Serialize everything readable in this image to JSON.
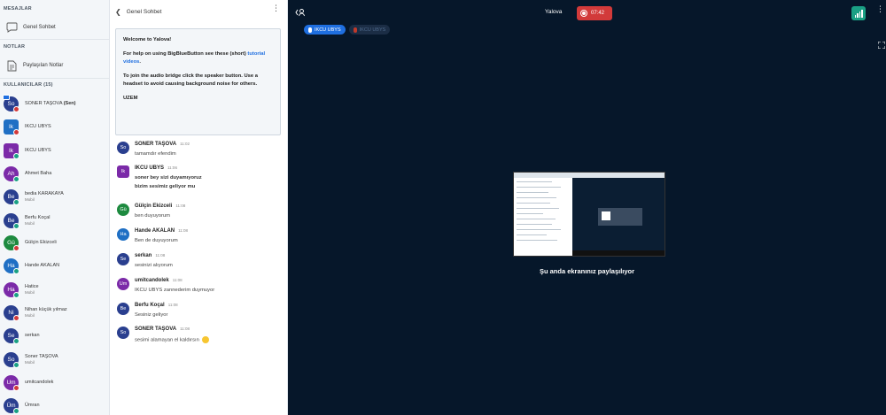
{
  "sidebar": {
    "messages_title": "MESAJLAR",
    "public_chat_label": "Genel Sohbet",
    "notes_title": "NOTLAR",
    "shared_notes_label": "Paylaşılan Notlar",
    "users_title": "KULLANICILAR (15)"
  },
  "users": [
    {
      "initials": "So",
      "name": "SONER TAŞOVA",
      "you": "(Sen)",
      "role": "",
      "color": "#2a3f8f",
      "square": false,
      "status": "mic-muted",
      "presenter": true
    },
    {
      "initials": "Ik",
      "name": "IKCU UBYS",
      "you": "",
      "role": "",
      "color": "#1f6fc4",
      "square": true,
      "status": "mic-muted",
      "presenter": false
    },
    {
      "initials": "Ik",
      "name": "IKCU UBYS",
      "you": "",
      "role": "",
      "color": "#7b2aa8",
      "square": true,
      "status": "listen",
      "presenter": false
    },
    {
      "initials": "Ah",
      "name": "Ahmet Baha",
      "you": "",
      "role": "",
      "color": "#7b2aa8",
      "square": false,
      "status": "listen",
      "presenter": false
    },
    {
      "initials": "Be",
      "name": "bedia KARAKAYA",
      "you": "",
      "role": "Mobil",
      "color": "#2a3f8f",
      "square": false,
      "status": "listen",
      "presenter": false
    },
    {
      "initials": "Be",
      "name": "Berfu Koçal",
      "you": "",
      "role": "Mobil",
      "color": "#2a3f8f",
      "square": false,
      "status": "listen",
      "presenter": false
    },
    {
      "initials": "Gü",
      "name": "Gülçin Ekizceli",
      "you": "",
      "role": "",
      "color": "#1d8a3f",
      "square": false,
      "status": "mic-muted",
      "presenter": false
    },
    {
      "initials": "Ha",
      "name": "Hande AKALAN",
      "you": "",
      "role": "",
      "color": "#1f6fc4",
      "square": false,
      "status": "listen",
      "presenter": false
    },
    {
      "initials": "Ha",
      "name": "Hatice",
      "you": "",
      "role": "Mobil",
      "color": "#7b2aa8",
      "square": false,
      "status": "listen",
      "presenter": false
    },
    {
      "initials": "Ni",
      "name": "Nihan küçük yılmaz",
      "you": "",
      "role": "Mobil",
      "color": "#2a3f8f",
      "square": false,
      "status": "mic-muted",
      "presenter": false
    },
    {
      "initials": "Se",
      "name": "serkan",
      "you": "",
      "role": "",
      "color": "#2a3f8f",
      "square": false,
      "status": "listen",
      "presenter": false
    },
    {
      "initials": "So",
      "name": "Soner TAŞOVA",
      "you": "",
      "role": "Mobil",
      "color": "#2a3f8f",
      "square": false,
      "status": "listen",
      "presenter": false
    },
    {
      "initials": "Um",
      "name": "umitcandolek",
      "you": "",
      "role": "",
      "color": "#7b2aa8",
      "square": false,
      "status": "mic-muted",
      "presenter": false
    },
    {
      "initials": "Üm",
      "name": "Ümran",
      "you": "",
      "role": "",
      "color": "#2a3f8f",
      "square": false,
      "status": "listen",
      "presenter": false
    }
  ],
  "chat": {
    "title": "Genel Sohbet",
    "welcome": {
      "line1": "Welcome to Yalova!",
      "line2_pre": "For help on using BigBlueButton see these (short) ",
      "line2_link": "tutorial videos",
      "line2_post": ".",
      "line3": "To join the audio bridge click the speaker button. Use a headset to avoid causing background noise for others.",
      "line4": "UZEM"
    },
    "messages": [
      {
        "initials": "So",
        "name": "SONER TAŞOVA",
        "time": "11:02",
        "color": "#2a3f8f",
        "square": false,
        "lines": [
          "tamamdır efendim"
        ],
        "bold": false
      },
      {
        "initials": "Ik",
        "name": "IKCU UBYS",
        "time": "11:06",
        "color": "#7b2aa8",
        "square": true,
        "lines": [
          "soner bey sizi duyamıyoruz",
          "bizim sesimiz geliyor mu"
        ],
        "bold": true
      },
      {
        "initials": "Gü",
        "name": "Gülçin Ekizceli",
        "time": "11:08",
        "color": "#1d8a3f",
        "square": false,
        "lines": [
          "ben duyuyorum"
        ],
        "bold": false
      },
      {
        "initials": "Ha",
        "name": "Hande AKALAN",
        "time": "11:08",
        "color": "#1f6fc4",
        "square": false,
        "lines": [
          "Ben de duyuyorum"
        ],
        "bold": false
      },
      {
        "initials": "Se",
        "name": "serkan",
        "time": "11:08",
        "color": "#2a3f8f",
        "square": false,
        "lines": [
          "sesinizi alıyorum"
        ],
        "bold": false
      },
      {
        "initials": "Um",
        "name": "umitcandolek",
        "time": "11:08",
        "color": "#7b2aa8",
        "square": false,
        "lines": [
          "IKCU UBYS zannederim duymuyor"
        ],
        "bold": false
      },
      {
        "initials": "Be",
        "name": "Berfu Koçal",
        "time": "11:08",
        "color": "#2a3f8f",
        "square": false,
        "lines": [
          "Sesiniz geliyor"
        ],
        "bold": false
      },
      {
        "initials": "So",
        "name": "SONER TAŞOVA",
        "time": "11:08",
        "color": "#2a3f8f",
        "square": false,
        "lines": [
          "sesimi alamayan el kaldırsın"
        ],
        "bold": false,
        "emoji": true
      }
    ]
  },
  "main": {
    "meeting_title": "Yalova",
    "recording_time": "07:42",
    "talkers": [
      {
        "label": "IKCU UBYS",
        "active": true
      },
      {
        "label": "IKCU UBYS",
        "active": false
      }
    ],
    "screenshare_message": "Şu anda ekranınız paylaşılıyor"
  },
  "colors": {
    "accent": "#1f6fe0",
    "main_bg": "#06172a",
    "record_red": "#d23a3a",
    "connection_green": "#1aa084"
  }
}
